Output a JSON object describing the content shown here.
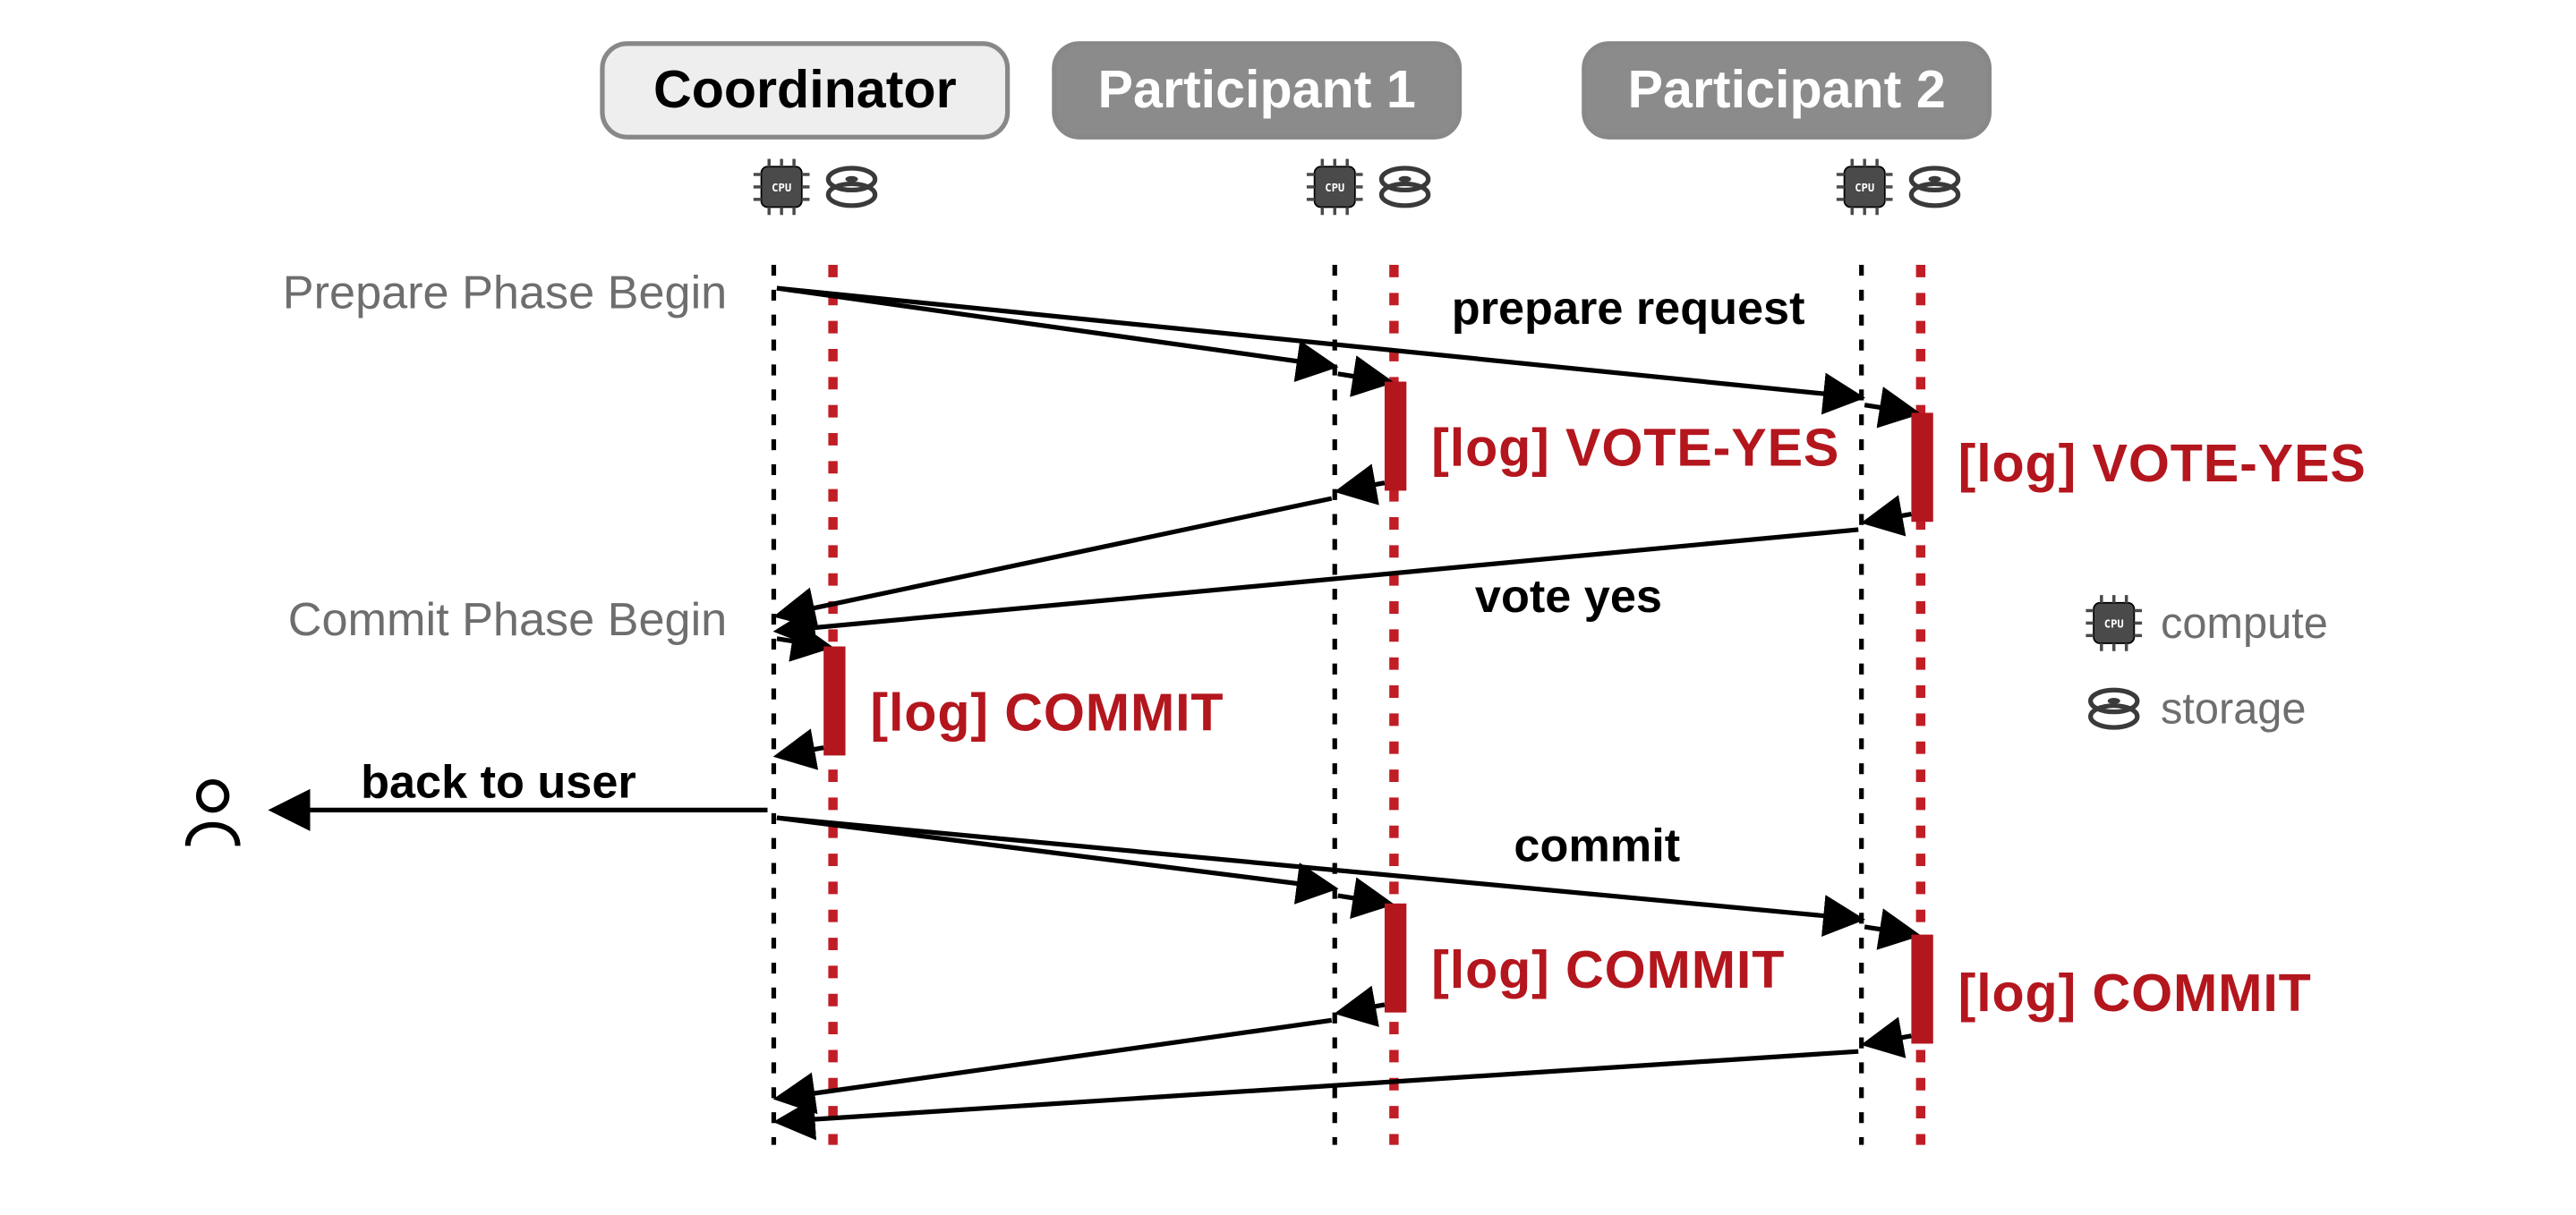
{
  "roles": {
    "coordinator": "Coordinator",
    "participant1": "Participant 1",
    "participant2": "Participant 2"
  },
  "phases": {
    "prepare": "Prepare Phase Begin",
    "commit": "Commit Phase Begin"
  },
  "messages": {
    "prepare_request": "prepare request",
    "vote_yes": "vote yes",
    "commit": "commit",
    "back_to_user": "back to user"
  },
  "logs": {
    "vote_yes_p1": "[log] VOTE-YES",
    "vote_yes_p2": "[log] VOTE-YES",
    "commit_coord": "[log] COMMIT",
    "commit_p1": "[log] COMMIT",
    "commit_p2": "[log] COMMIT"
  },
  "legend": {
    "compute": "compute",
    "storage": "storage"
  }
}
